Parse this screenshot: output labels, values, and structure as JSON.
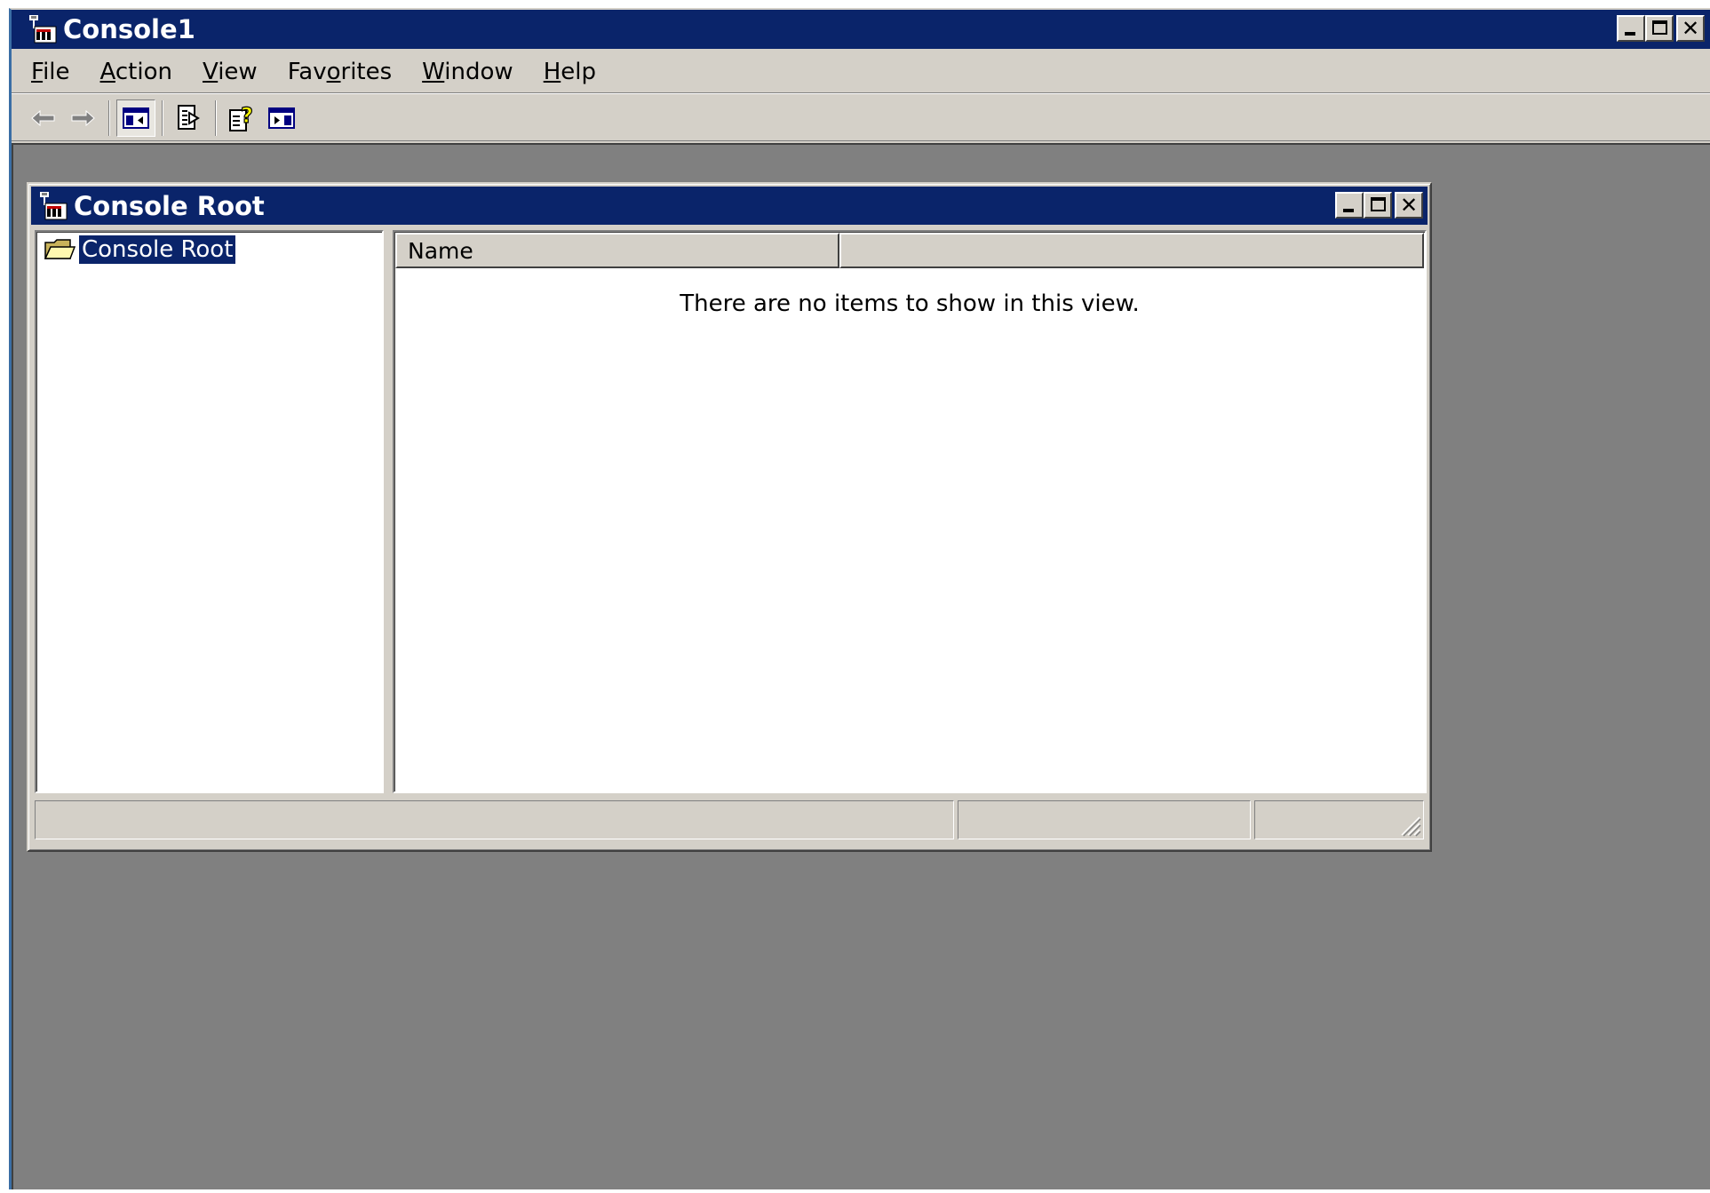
{
  "app": {
    "title": "Console1",
    "icon": "mmc-console-icon"
  },
  "menubar": {
    "items": [
      {
        "label": "File",
        "mnemonic": "F"
      },
      {
        "label": "Action",
        "mnemonic": "A"
      },
      {
        "label": "View",
        "mnemonic": "V"
      },
      {
        "label": "Favorites",
        "mnemonic": "o"
      },
      {
        "label": "Window",
        "mnemonic": "W"
      },
      {
        "label": "Help",
        "mnemonic": "H"
      }
    ]
  },
  "toolbar": {
    "buttons": [
      {
        "name": "back-arrow-icon",
        "enabled": false
      },
      {
        "name": "forward-arrow-icon",
        "enabled": false
      },
      {
        "name": "show-hide-console-tree-icon",
        "pressed": true
      },
      {
        "name": "export-list-icon"
      },
      {
        "name": "help-icon"
      },
      {
        "name": "show-hide-action-pane-icon"
      }
    ]
  },
  "child_window": {
    "title": "Console Root",
    "tree": {
      "root_label": "Console Root",
      "root_icon": "folder-open-icon",
      "selected": true
    },
    "list": {
      "columns": [
        "Name",
        ""
      ],
      "empty_message": "There are no items to show in this view."
    },
    "status": [
      "",
      "",
      ""
    ]
  },
  "colors": {
    "titlebar_active": "#0a246a",
    "face": "#d4d0c8",
    "mdi_background": "#808080",
    "selection": "#0a246a"
  }
}
